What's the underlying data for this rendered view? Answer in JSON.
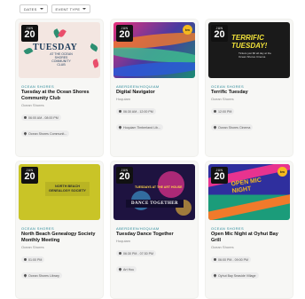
{
  "filters": [
    {
      "label": "DATES"
    },
    {
      "label": "EVENT TYPE"
    }
  ],
  "events": [
    {
      "month": "JUN",
      "day": "20",
      "org": "OCEAN SHORES",
      "title": "Tuesday at the Ocean Shores Community Club",
      "venue": "Ocean Shores",
      "time": "06:00 AM - 08:00 PM",
      "location": "Ocean Shores Communit...",
      "poster": {
        "big": "TUESDAY",
        "small": "AT THE OCEAN SHORES COMMUNITY CLUB"
      }
    },
    {
      "month": "JUN",
      "day": "20",
      "org": "ABERDEEN/HOQUIAM",
      "title": "Digital Navigator",
      "venue": "Hoquiam",
      "time": "06:30 AM - 12:00 PM",
      "location": "Hoquiam Timberland Lib...",
      "poster": {
        "logo": "tm"
      }
    },
    {
      "month": "JUN",
      "day": "20",
      "org": "OCEAN SHORES",
      "title": "Terrific Tuesday",
      "venue": "Ocean Shores",
      "time": "12:00 PM",
      "location": "Ocean Shores Cinema",
      "poster": {
        "big": "TERRIFIC TUESDAY!",
        "small": "Tickets just $6 all day at the Ocean Shores Cinema"
      }
    },
    {
      "month": "JUN",
      "day": "20",
      "org": "OCEAN SHORES",
      "title": "North Beach Genealogy Society Monthly Meeting",
      "venue": "Ocean Shores",
      "time": "01:00 PM",
      "location": "Ocean Shores Library",
      "poster": {
        "big": "NORTH BEACH GENEALOGY SOCIETY"
      }
    },
    {
      "month": "JUN",
      "day": "20",
      "org": "ABERDEEN/HOQUIAM",
      "title": "Tuesday Dance Together",
      "venue": "Hoquiam",
      "time": "06:30 PM - 07:30 PM",
      "location": "Art Hou",
      "poster": {
        "big": "DANCE TOGETHER",
        "small": "TUESDAYS AT THE ART HOUSE"
      }
    },
    {
      "month": "JUN",
      "day": "20",
      "org": "OCEAN SHORES",
      "title": "Open Mic Night at Oyhut Bay Grill",
      "venue": "Ocean Shores",
      "time": "06:00 PM - 09:00 PM",
      "location": "Oyhut Bay Seaside Village",
      "poster": {
        "big": "OPEN MIC NIGHT",
        "logo": "tm"
      }
    }
  ]
}
